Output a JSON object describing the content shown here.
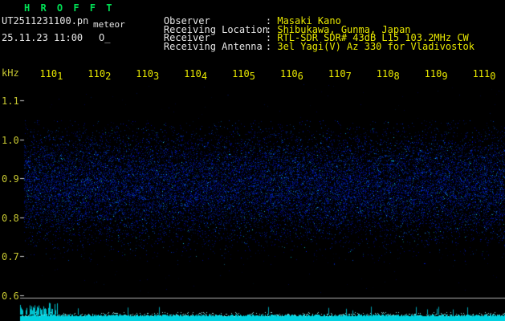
{
  "header": {
    "app_title": "H R O F F T",
    "filename": "UT2511231100.pn",
    "tag": "meteor",
    "datetime": "25.11.23 11:00",
    "indicator": "O_",
    "colon": ": ",
    "meta": [
      {
        "label": "Observer",
        "value": "Masaki Kano"
      },
      {
        "label": "Receiving Location",
        "value": "Shibukawa, Gunma, Japan"
      },
      {
        "label": "Receiver",
        "value": "RTL-SDR SDR# 43dB L15 103.2MHz CW"
      },
      {
        "label": "Receiving Antenna",
        "value": "3el Yagi(V) Az 330 for Vladivostok"
      }
    ]
  },
  "chart_data": {
    "type": "heatmap",
    "title": "HROFFT 10-minute radio meteor spectrogram, 25.11.23 11:00 UT",
    "ylabel": "kHz",
    "y_ticks": [
      "1.1",
      "1.0",
      "0.9",
      "0.8",
      "0.7",
      "0.6"
    ],
    "y_range_khz": [
      0.55,
      1.15
    ],
    "x_ticks": [
      "1101",
      "1102",
      "1103",
      "1104",
      "1105",
      "1106",
      "1107",
      "1108",
      "1109",
      "1110"
    ],
    "x_axis_meaning": "time of day HHMM, one-minute steps",
    "grid": false,
    "legend": "none",
    "noise_band": {
      "center_khz": 0.88,
      "halfwidth_khz": 0.13,
      "description": "diffuse dark-blue background noise band, no meteor echo streaks visible"
    },
    "baseline_trace": {
      "description": "cyan signal-level trace along bottom edge, flat with small burst at far left",
      "separator_line_y_khz": 0.595
    }
  },
  "colors": {
    "background": "#000000",
    "title_green": "#00e055",
    "header_white": "#e6e6e6",
    "value_yellow": "#e8e800",
    "axis_label_yellow": "#c8c832",
    "noise_blue": "#2233cc",
    "trace_cyan": "#00dcEB",
    "separator_gray": "#b0b0b0"
  }
}
